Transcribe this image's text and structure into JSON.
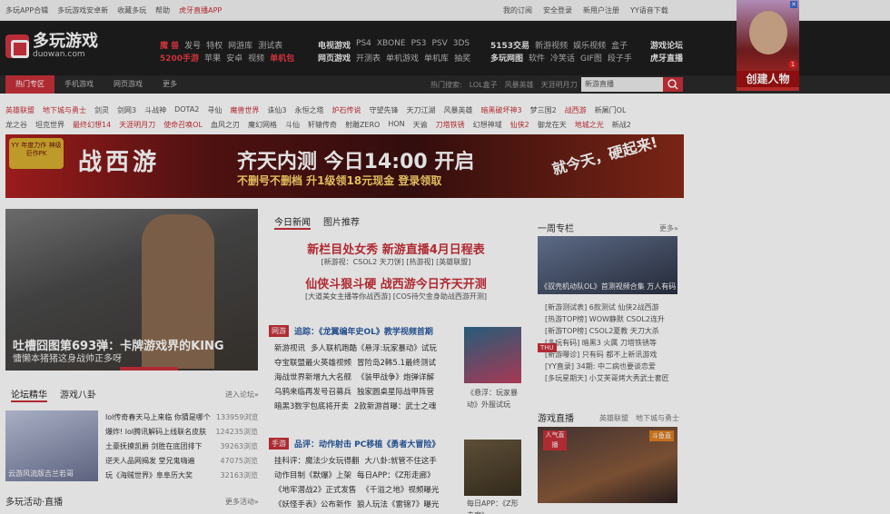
{
  "topbar": {
    "left": [
      "多玩APP合辑",
      "多玩游戏安卓新",
      "收藏多玩",
      "帮助",
      "虎牙直播APP"
    ],
    "right": [
      "我的订阅",
      "安全登录",
      "新用户注册",
      "YY语音下载"
    ]
  },
  "logo": {
    "name": "多玩游戏",
    "domain": "duowan.com"
  },
  "header": {
    "row1a": [
      "魔 兽",
      "发号",
      "特权",
      "网游库",
      "测试表"
    ],
    "row1b": [
      "5200手游",
      "苹果",
      "安卓",
      "视频",
      "单机包"
    ],
    "row2a": [
      "电视游戏",
      "PS4",
      "XBONE",
      "PS3",
      "PSV",
      "3DS"
    ],
    "row2b": [
      "网页游戏",
      "开测表",
      "单机游戏",
      "单机库",
      "抽奖"
    ],
    "row3a": [
      "5153交易",
      "新游视频",
      "娱乐视频",
      "盒子"
    ],
    "row3b": [
      "多玩网图",
      "软件",
      "冷笑话",
      "GIF图",
      "段子手"
    ],
    "row4a": "游戏论坛",
    "row4b": "虎牙直播"
  },
  "nav": {
    "tabs": [
      "热门专区",
      "手机游戏",
      "网页游戏",
      "更多"
    ],
    "hot_label": "热门搜索:",
    "hot": [
      "LOL盒子",
      "风暴英雄",
      "天涯明月刀"
    ],
    "search_value": "新游直播"
  },
  "games1": [
    "英雄联盟",
    "地下城与勇士",
    "剑灵",
    "剑网3",
    "斗战神",
    "DOTA2",
    "寻仙",
    "魔兽世界",
    "诛仙3",
    "永恒之塔",
    "炉石传说",
    "守望先锋",
    "天刀江湖",
    "风暴英雄",
    "暗黑破坏神3",
    "梦三国2",
    "战西游",
    "新屠门OL"
  ],
  "games2": [
    "龙之谷",
    "坦克世界",
    "最终幻想14",
    "天涯明月刀",
    "使命召唤OL",
    "血风之刃",
    "魔幻网格",
    "斗仙",
    "轩辕传奇",
    "射雕ZERO",
    "HON",
    "天谕",
    "刀塔铁锈",
    "幻想神域",
    "仙侠2",
    "御龙在天",
    "地城之光",
    "新战2"
  ],
  "banner": {
    "yy": "YY 年度力作 神级巨作PK",
    "logo": "战西游",
    "title": "齐天内测 今日14:00 开启",
    "sub": "不删号不删档 升1级领18元现金 登录领取",
    "side": "就今天，硬起来!"
  },
  "hero": {
    "title": "吐槽囧图第693弹：卡牌游戏界的KING",
    "sub": "慵懒本猪猪这身战帅正多呀"
  },
  "forum": {
    "tabs": [
      "论坛精华",
      "游戏八卦"
    ],
    "more": "进入论坛»",
    "thumb_cap": "云游风流版吉兰若哥",
    "items": [
      [
        "lol传奇春天马上来临 你猜是哪个",
        "133959浏览"
      ],
      [
        "爆炸! lol腾讯解码上线联名皮肤",
        "124235浏览"
      ],
      [
        "土豪抚摸凯爵 剑胜在底团排下",
        "39263浏览"
      ],
      [
        "逆天人品网揭发 堂兄鬼嗨遍",
        "47075浏览"
      ],
      [
        "玩《海贼世界》阜阜历大奖",
        "32163浏览"
      ]
    ]
  },
  "activity": {
    "title": "多玩活动·直播",
    "more": "更多活动»"
  },
  "news": {
    "tabs": [
      "今日新闻",
      "图片推荐"
    ],
    "headline1": "新栏目处女秀 新游直播4月日程表",
    "sub1": "[新游视：CSOL2 天刀饼] [热游视] [英雄联盟]",
    "headline2": "仙侠斗狠斗硬 战西游今日齐天开测",
    "sub2": "[大道美女主播等你战西游] [COS待欠金身助战西游开测]"
  },
  "sec1": {
    "tag": "网游",
    "title": "追踪：《龙翼编年史OL》教学视频首期",
    "rows": [
      [
        "新游视讯",
        "多人联机跑酷《悬浮:玩家暴动》试玩"
      ],
      [
        "夺宝联盟最火英雄视频",
        "冒险岛2韩5.1最终测试"
      ],
      [
        "海战世界新增九大名舰",
        "《装甲战争》炮弹详解"
      ],
      [
        "乌鸦来临再发号召募兵",
        "独家圆桌星际战甲阵营"
      ],
      [
        "暗黑3数字包底将开卖",
        "2款新游首曝：武士之魂"
      ]
    ],
    "thumb": "《悬浮：玩家暴动》外服试玩"
  },
  "sec2": {
    "tag": "手游",
    "title": "品评：动作射击 PC移植《勇者大冒险》",
    "rows": [
      [
        "挂科评：魔法少女玩得翻",
        "大八卦:就管不住这手"
      ],
      [
        "动作目制《默爆》上架",
        "每日APP：《Z形走廊》"
      ],
      [
        "《地牢潜战2》正式发售",
        "《千溢之地》视频曝光"
      ],
      [
        "《妖怪手表》公布新作",
        "狼人玩法《雷锦7》曝光"
      ]
    ],
    "thumb": "每日APP：《Z形走廊》"
  },
  "column": {
    "title": "一周专栏",
    "more": "更多»",
    "img_cap": "《驭壳机动队OL》首测视频合集 万人有码",
    "items": [
      "[新游测试表] 6款测试 仙侠2战西游",
      "[热游TOP榜] WOW静默 CSOL2连升",
      "[新游TOP榜] CSOL2夏教 天刀大杀",
      "[多玩有码] 暗黑3 火属 刀塔铁锈等",
      "[新游曝诊] 只有码 都不上新讯游戏",
      "[YY直录] 34期: 中二病也要谈恋爱",
      "[多玩星期天] 小艾芙哥烤大秀武士套匠"
    ],
    "thu": "THU"
  },
  "live": {
    "title": "游戏直播",
    "links": [
      "英雄联盟",
      "地下城与勇士"
    ],
    "img_tag": "人气直播",
    "img_side": "斗鱼直"
  },
  "ad": {
    "text": "创建人物",
    "badge": "1",
    "close": "✕"
  },
  "colors": {
    "accent": "#c9303a",
    "dark": "#1e1e1e",
    "link": "#2a5aa0"
  }
}
